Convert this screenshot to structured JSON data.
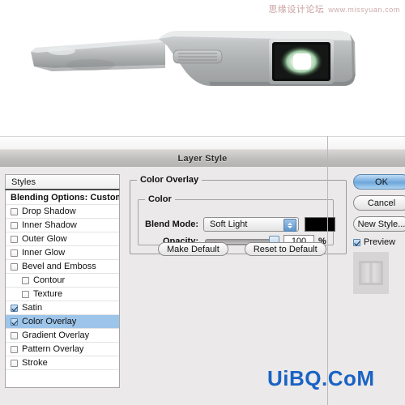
{
  "watermarks": {
    "top_cn": "思缘设计论坛",
    "top_en": "www.missyuan.com",
    "bottom": "UiBQ.CoM",
    "bottom_color": "#1a63c4"
  },
  "photo": {
    "alt": "metallic-device-with-dark-lens-screen",
    "body_color": "#b9bcbd",
    "lens_glow_color": "#e9f7ea"
  },
  "dialog": {
    "title": "Layer Style",
    "styles_header": "Styles",
    "styles": [
      {
        "label": "Blending Options: Custom",
        "checked": null,
        "indent": false,
        "selected": false,
        "bold": true
      },
      {
        "label": "Drop Shadow",
        "checked": false,
        "indent": false,
        "selected": false,
        "bold": false
      },
      {
        "label": "Inner Shadow",
        "checked": false,
        "indent": false,
        "selected": false,
        "bold": false
      },
      {
        "label": "Outer Glow",
        "checked": false,
        "indent": false,
        "selected": false,
        "bold": false
      },
      {
        "label": "Inner Glow",
        "checked": false,
        "indent": false,
        "selected": false,
        "bold": false
      },
      {
        "label": "Bevel and Emboss",
        "checked": false,
        "indent": false,
        "selected": false,
        "bold": false
      },
      {
        "label": "Contour",
        "checked": false,
        "indent": true,
        "selected": false,
        "bold": false
      },
      {
        "label": "Texture",
        "checked": false,
        "indent": true,
        "selected": false,
        "bold": false
      },
      {
        "label": "Satin",
        "checked": true,
        "indent": false,
        "selected": false,
        "bold": false
      },
      {
        "label": "Color Overlay",
        "checked": true,
        "indent": false,
        "selected": true,
        "bold": false
      },
      {
        "label": "Gradient Overlay",
        "checked": false,
        "indent": false,
        "selected": false,
        "bold": false
      },
      {
        "label": "Pattern Overlay",
        "checked": false,
        "indent": false,
        "selected": false,
        "bold": false
      },
      {
        "label": "Stroke",
        "checked": false,
        "indent": false,
        "selected": false,
        "bold": false
      }
    ],
    "panel": {
      "group_title": "Color Overlay",
      "subgroup_title": "Color",
      "blend_mode_label": "Blend Mode:",
      "blend_mode_value": "Soft Light",
      "color_swatch": "#000000",
      "opacity_label": "Opacity:",
      "opacity_value": "100",
      "opacity_unit": "%",
      "make_default": "Make Default",
      "reset_to_default": "Reset to Default"
    },
    "buttons": {
      "ok": "OK",
      "cancel": "Cancel",
      "new_style": "New Style...",
      "preview_label": "Preview",
      "preview_checked": true
    }
  }
}
